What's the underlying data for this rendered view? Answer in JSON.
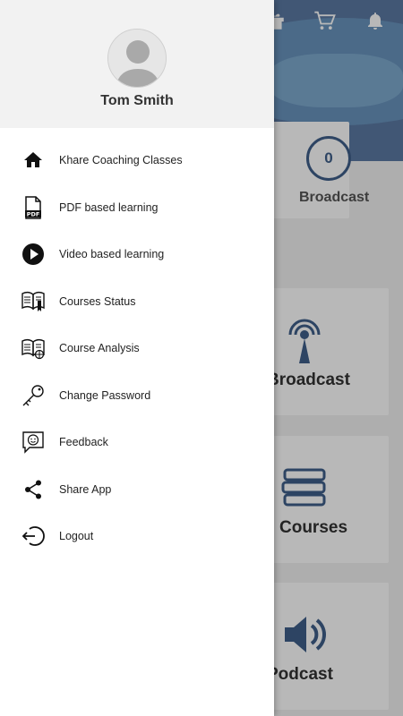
{
  "background": {
    "stat_card": {
      "count": "0",
      "label": "Broadcast"
    },
    "cards": [
      {
        "label": "Broadcast",
        "icon": "broadcast-tower-icon"
      },
      {
        "label": "Courses",
        "icon": "books-stack-icon"
      },
      {
        "label": "Podcast",
        "icon": "speaker-icon"
      }
    ],
    "topbar_icons": [
      "gift-icon",
      "cart-icon",
      "bell-icon"
    ]
  },
  "drawer": {
    "user_name": "Tom Smith",
    "items": [
      {
        "label": "Khare Coaching Classes",
        "icon": "home-icon"
      },
      {
        "label": "PDF based learning",
        "icon": "pdf-file-icon"
      },
      {
        "label": "Video based learning",
        "icon": "play-circle-icon"
      },
      {
        "label": "Courses Status",
        "icon": "book-status-icon"
      },
      {
        "label": "Course Analysis",
        "icon": "book-analysis-icon"
      },
      {
        "label": "Change Password",
        "icon": "key-icon"
      },
      {
        "label": "Feedback",
        "icon": "feedback-smile-icon"
      },
      {
        "label": "Share App",
        "icon": "share-icon"
      },
      {
        "label": "Logout",
        "icon": "logout-icon"
      }
    ]
  },
  "colors": {
    "accent": "#3f5f8a",
    "header_bg": "#5b79a3",
    "drawer_header_bg": "#f2f2f2"
  }
}
